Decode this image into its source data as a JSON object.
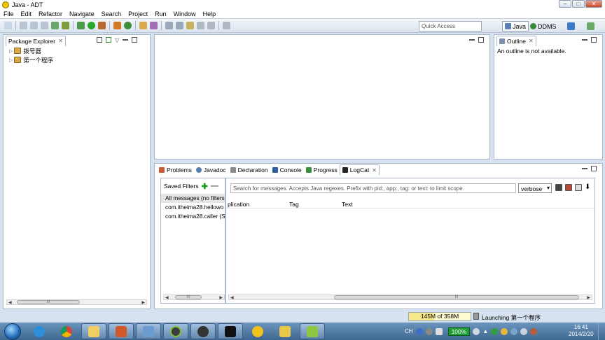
{
  "window": {
    "title": "Java - ADT",
    "minimize": "–",
    "maximize": "□",
    "close": "✕"
  },
  "menu": [
    "File",
    "Edit",
    "Refactor",
    "Navigate",
    "Search",
    "Project",
    "Run",
    "Window",
    "Help"
  ],
  "toolbar": {
    "quick_access_placeholder": "Quick Access",
    "perspectives": [
      "Java",
      "DDMS"
    ]
  },
  "package_explorer": {
    "title": "Package Explorer",
    "projects": [
      "拨号器",
      "第一个程序"
    ],
    "scroll_thumb": "III"
  },
  "outline": {
    "title": "Outline",
    "message": "An outline is not available."
  },
  "bottom_tabs": [
    "Problems",
    "Javadoc",
    "Declaration",
    "Console",
    "Progress",
    "LogCat"
  ],
  "logcat": {
    "saved_filters_label": "Saved Filters",
    "add_label": "✚",
    "remove_label": "—",
    "filters": [
      "All messages (no filters",
      "com.itheima28.hellowo",
      "com.itheima28.caller (S"
    ],
    "search_placeholder": "Search for messages. Accepts Java regexes. Prefix with pid:, app:, tag: or text: to limit scope.",
    "level": "verbose",
    "columns": [
      "plication",
      "Tag",
      "Text"
    ],
    "filters_scroll_thumb": "III",
    "main_scroll_thumb": "III"
  },
  "status": {
    "heap": "145M of 358M",
    "heap_used_fraction": 0.405,
    "launching": "Launching 第一个程序"
  },
  "taskbar": {
    "tray_lang": "CH",
    "battery": "100%",
    "time": "16:41",
    "date": "2014/2/20"
  },
  "colors": {
    "workbench_bg": "#d6e2f0",
    "taskbar": "#4b7299",
    "add_green": "#1b9b1b",
    "battery_green": "#1c9c33"
  }
}
